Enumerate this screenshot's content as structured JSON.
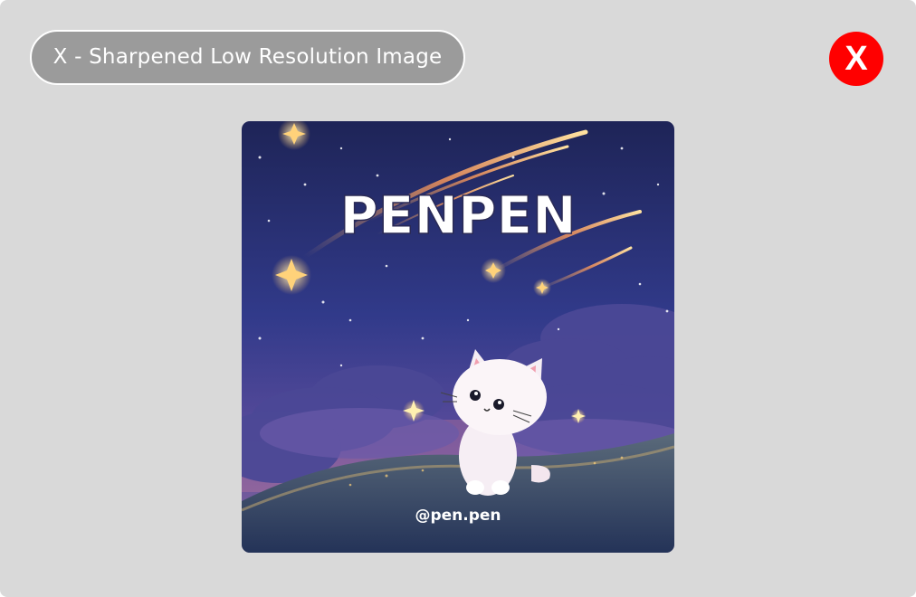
{
  "dialog": {
    "title": "X - Sharpened Low Resolution Image",
    "close_label": "X"
  },
  "image": {
    "title_text": "PENPEN",
    "handle_text": "@pen.pen"
  },
  "colors": {
    "background": "#d9d9d9",
    "title_pill": "#9b9b9b",
    "close_button": "#ff0000"
  }
}
